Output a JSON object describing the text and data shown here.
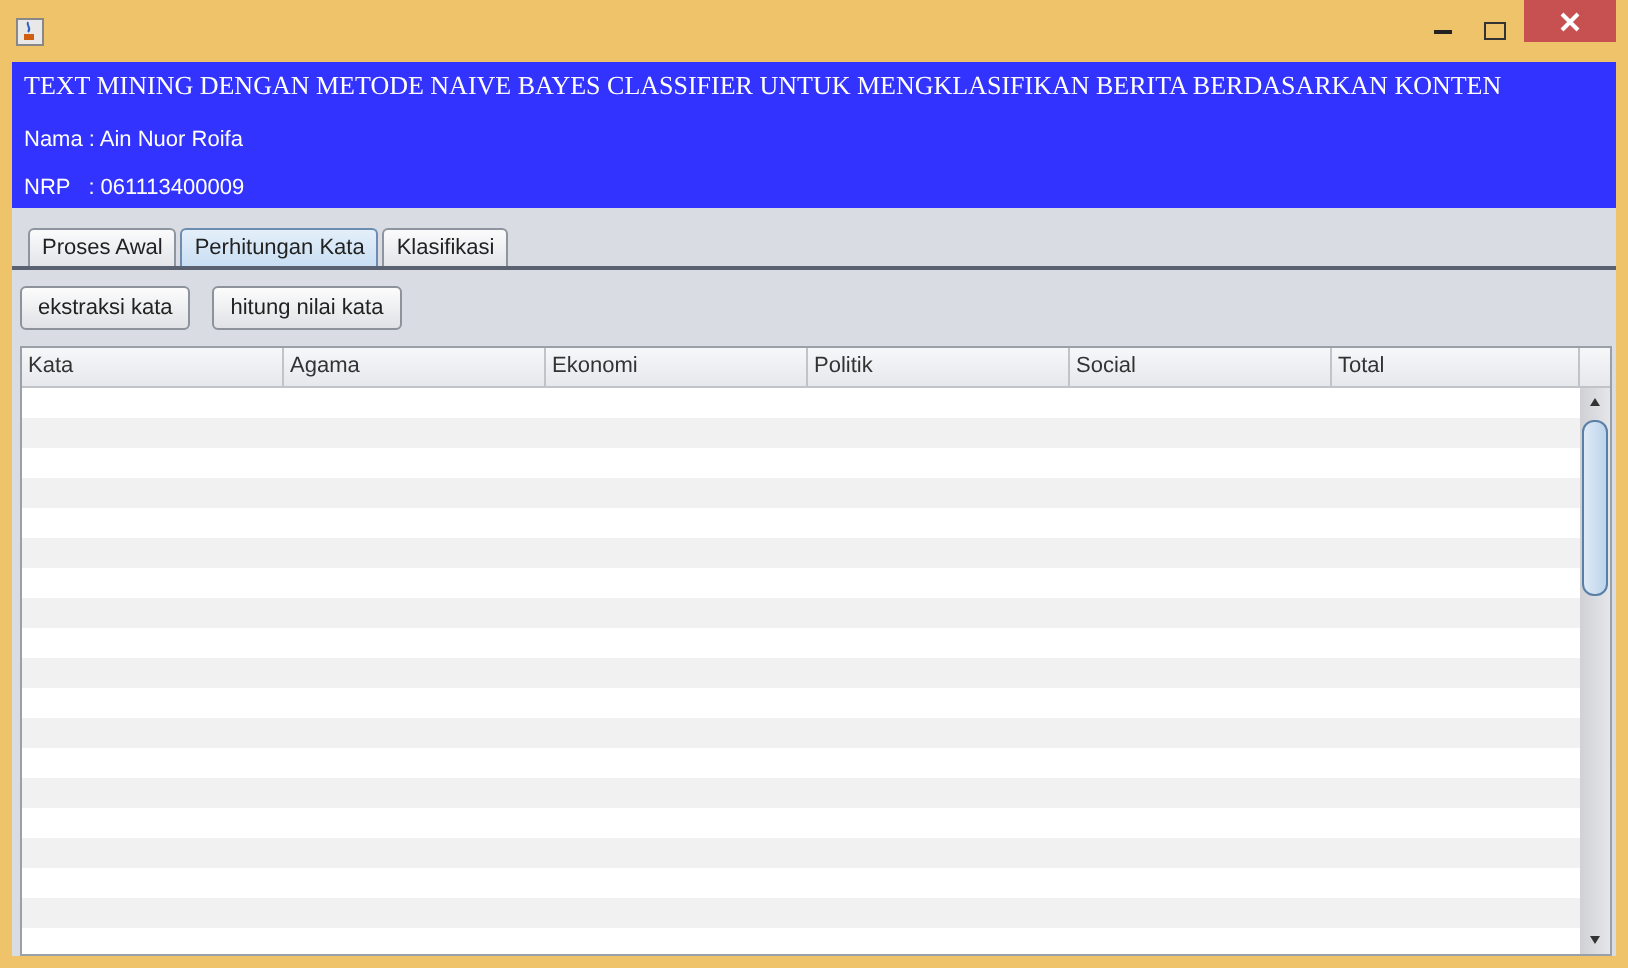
{
  "header": {
    "title": "TEXT MINING DENGAN METODE NAIVE BAYES CLASSIFIER UNTUK MENGKLASIFIKAN BERITA BERDASARKAN KONTEN",
    "name_line": "Nama : Ain Nuor Roifa",
    "nrp_line": "NRP   : 061113400009"
  },
  "tabs": [
    {
      "label": "Proses Awal",
      "selected": false
    },
    {
      "label": "Perhitungan Kata",
      "selected": true
    },
    {
      "label": "Klasifikasi",
      "selected": false
    }
  ],
  "buttons": [
    "ekstraksi kata",
    "hitung nilai kata"
  ],
  "table": {
    "columns": [
      "Kata",
      "Agama",
      "Ekonomi",
      "Politik",
      "Social",
      "Total"
    ]
  }
}
